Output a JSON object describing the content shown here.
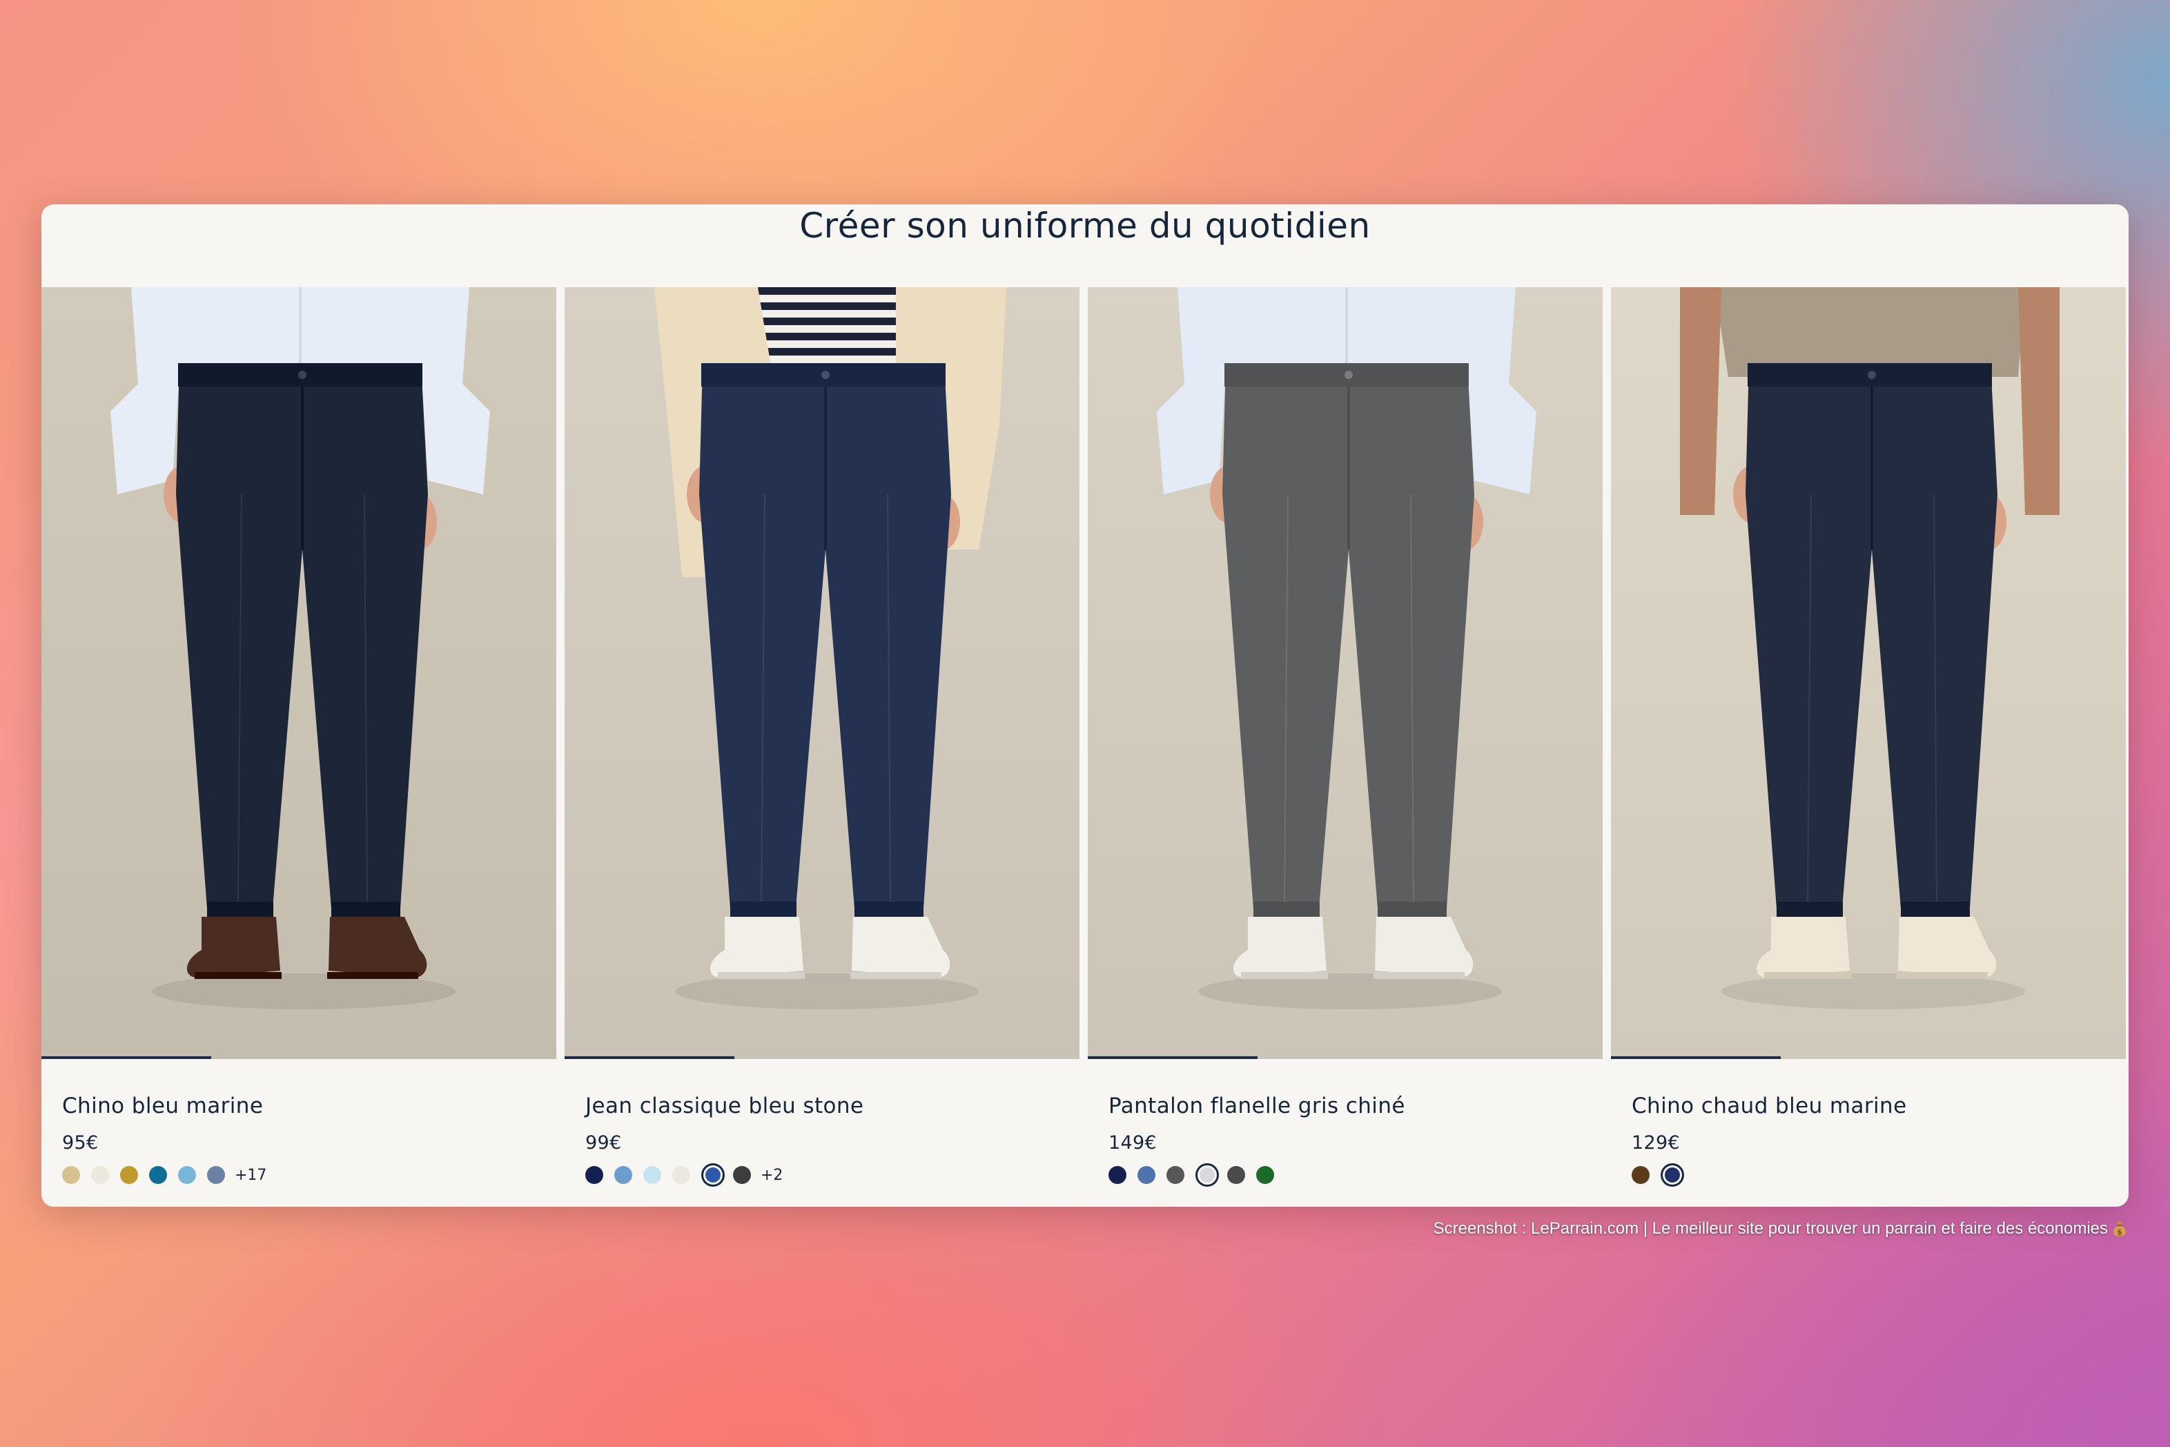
{
  "section": {
    "title": "Créer son uniforme du quotidien"
  },
  "products": [
    {
      "name": "Chino bleu marine",
      "price": "95€",
      "image_progress": 0.33,
      "swatches": [
        {
          "color": "#d6c28e",
          "selected": false
        },
        {
          "color": "#ede8dd",
          "selected": false
        },
        {
          "color": "#c09a2c",
          "selected": false
        },
        {
          "color": "#0f6e98",
          "selected": false
        },
        {
          "color": "#79b7d8",
          "selected": false
        },
        {
          "color": "#6b82a2",
          "selected": false
        }
      ],
      "more": "+17",
      "photo": {
        "bg": "#ccc5b6",
        "pants": "#1d2538",
        "top": "#e6edf6",
        "shoes": "#4a2c20",
        "style": "shirt"
      }
    },
    {
      "name": "Jean classique bleu stone",
      "price": "99€",
      "image_progress": 0.33,
      "swatches": [
        {
          "color": "#14204f",
          "selected": false
        },
        {
          "color": "#6d9dcc",
          "selected": false
        },
        {
          "color": "#c6e3f4",
          "selected": false
        },
        {
          "color": "#ece8de",
          "selected": false
        },
        {
          "color": "#2b59a8",
          "selected": true
        },
        {
          "color": "#3d3d3d",
          "selected": false
        }
      ],
      "more": "+2",
      "photo": {
        "bg": "#d2cbbd",
        "pants": "#243150",
        "top": "#ecdcc0",
        "shoes": "#f1efe8",
        "style": "cardigan"
      }
    },
    {
      "name": "Pantalon flanelle gris chiné",
      "price": "149€",
      "image_progress": 0.33,
      "swatches": [
        {
          "color": "#14204f",
          "selected": false
        },
        {
          "color": "#4f74ad",
          "selected": false
        },
        {
          "color": "#575757",
          "selected": false
        },
        {
          "color": "#d9d9dd",
          "selected": true
        },
        {
          "color": "#4a4a4a",
          "selected": false
        },
        {
          "color": "#1c6a27",
          "selected": false
        }
      ],
      "more": "",
      "photo": {
        "bg": "#d3cdbf",
        "pants": "#5d5e60",
        "top": "#e3ebf6",
        "shoes": "#efede6",
        "style": "shirt"
      }
    },
    {
      "name": "Chino chaud bleu marine",
      "price": "129€",
      "image_progress": 0.33,
      "swatches": [
        {
          "color": "#5a3c18",
          "selected": false
        },
        {
          "color": "#1f3168",
          "selected": true
        }
      ],
      "more": "",
      "photo": {
        "bg": "#d9d2c3",
        "pants": "#222b40",
        "top": "#a89b88",
        "shoes": "#f0e6d6",
        "style": "tee"
      }
    }
  ],
  "footer_note": "Screenshot : LeParrain.com | Le meilleur site pour trouver un parrain et faire des économies",
  "icons": {
    "footer": "moneybag-icon",
    "slider": "image-progress-bar"
  }
}
